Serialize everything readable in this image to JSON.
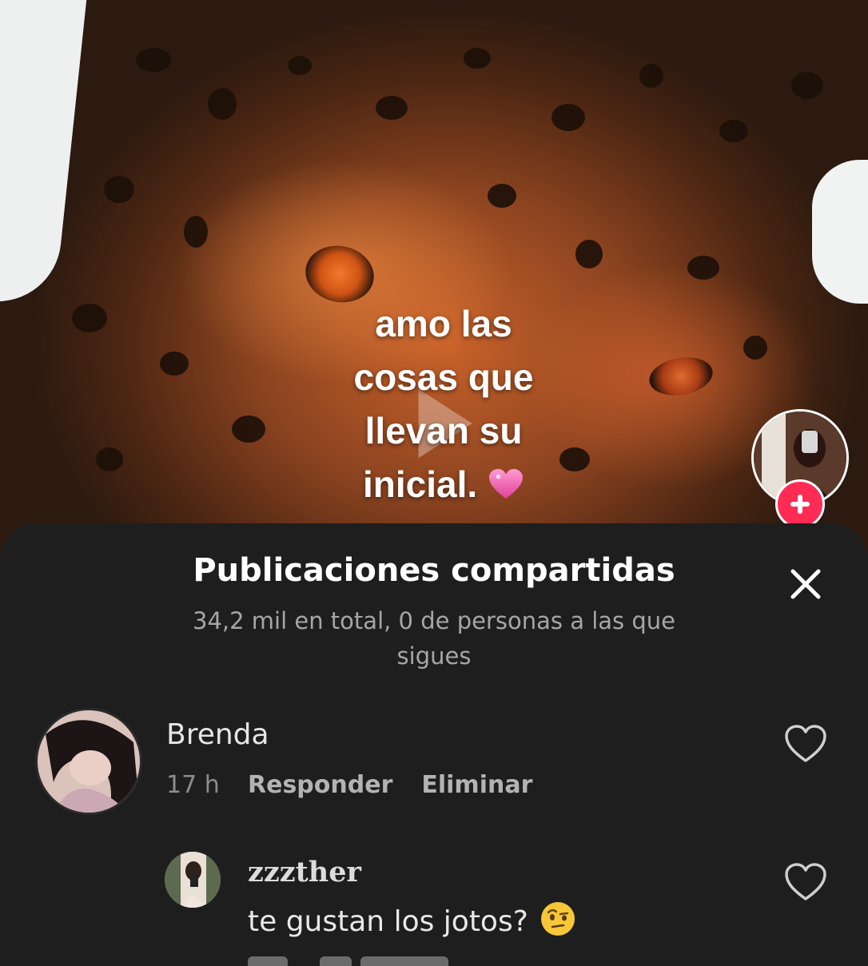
{
  "video": {
    "caption_lines": [
      "amo las",
      "cosas que",
      "llevan su",
      "inicial."
    ],
    "caption_emoji": "sparkling-heart",
    "play_icon": "play-icon",
    "creator_avatar_icon": "avatar",
    "follow_icon": "plus-icon",
    "accent_color": "#fe2c55"
  },
  "sheet": {
    "title": "Publicaciones compartidas",
    "subtitle": "34,2 mil en total, 0 de personas a las que sigues",
    "close_icon": "close-icon",
    "background": "#1e1e1e"
  },
  "comments": [
    {
      "username": "Brenda",
      "time": "17 h",
      "reply_label": "Responder",
      "delete_label": "Eliminar",
      "like_icon": "heart-outline-icon"
    },
    {
      "username": "zzzther",
      "text": "te gustan los jotos?",
      "emoji": "face-with-raised-eyebrow",
      "like_icon": "heart-outline-icon"
    }
  ]
}
